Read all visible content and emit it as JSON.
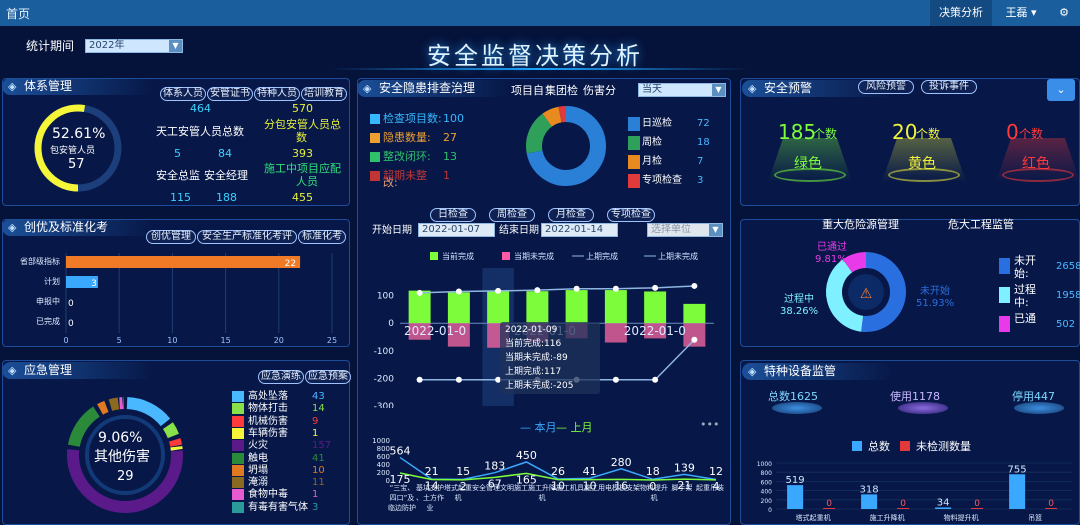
{
  "nav": {
    "brand": "首页",
    "menu": "决策分析",
    "user": "王磊 ▾",
    "gear": "⚙"
  },
  "title": "安全监督决策分析",
  "period": {
    "label": "统计期间",
    "value": "2022年"
  },
  "system": {
    "title": "体系管理",
    "pct": "52.61%",
    "pct_label": "包安管人员",
    "count": "57",
    "pills": [
      "体系人员",
      "安管证书",
      "特种人员",
      "培训教育"
    ],
    "v1": "464",
    "v2": "570",
    "lab_a": "天工安管人员总数",
    "lab_b1": "分包安管人员总",
    "lab_b2": "数",
    "r2a": "5",
    "r2b": "84",
    "r2c": "393",
    "lab_c": "安全总监",
    "lab_d": "安全经理",
    "lab_e1": "施工中项目应配",
    "lab_e2": "人员",
    "r3a": "115",
    "r3b": "188",
    "r3c": "455"
  },
  "hazard": {
    "title": "安全隐患排查治理",
    "tabs_text": "项目自",
    "tab2": "集团检",
    "tab3": "伤害分",
    "select": "当天",
    "stats": [
      {
        "label": "检查项目数:",
        "value": "100",
        "color": "#35b8ff"
      },
      {
        "label": "隐患数量:",
        "value": "27",
        "color": "#f0a030"
      },
      {
        "label": "整改闭环:",
        "value": "13",
        "color": "#2fc06a"
      },
      {
        "label": "超期未整",
        "value": "1",
        "color": "#c23535"
      }
    ],
    "stat4b": "改:",
    "legend": [
      {
        "label": "日巡检",
        "value": "72",
        "color": "#2a7fd6"
      },
      {
        "label": "周检",
        "value": "18",
        "color": "#2fa05a"
      },
      {
        "label": "月检",
        "value": "7",
        "color": "#e88a20"
      },
      {
        "label": "专项检查",
        "value": "3",
        "color": "#e03a3a"
      }
    ],
    "pie_values": [
      72,
      18,
      7,
      3
    ],
    "tabs2": [
      "日检查",
      "周检查",
      "月检查",
      "专项检查"
    ],
    "start_label": "开始日期",
    "start": "2022-01-07",
    "end_label": "结束日期",
    "end": "2022-01-14",
    "unit": "选择单位",
    "legend2": [
      "当前完成",
      "当期未完成",
      "上期完成",
      "上期未完成"
    ],
    "tooltip": [
      "2022-01-09",
      "当前完成:116",
      "当期未完成:-89",
      "上期完成:117",
      "上期未完成:-205"
    ],
    "axis_date": "2022-01-0"
  },
  "warn": {
    "title": "安全预警",
    "pill1": "风险预警",
    "pill2": "投诉事件",
    "items": [
      {
        "num": "185",
        "unit": "个数",
        "label": "绿色",
        "color": "#7cfc3a"
      },
      {
        "num": "20",
        "unit": "个数",
        "label": "黄色",
        "color": "#f2f23a"
      },
      {
        "num": "0",
        "unit": "个数",
        "label": "红色",
        "color": "#ff3a3a"
      }
    ]
  },
  "major": {
    "title": "重大危险源管理",
    "title2": "危大工程监管",
    "passed": "已通过",
    "passed_pct": "9.81%",
    "proc": "过程中",
    "proc_pct": "38.26%",
    "notstart": "未开始",
    "notstart_pct": "51.93%",
    "legend": [
      {
        "l1": "未开",
        "l2": "始:",
        "v": "2658",
        "color": "#2a6fe0"
      },
      {
        "l1": "过程",
        "l2": "中:",
        "v": "1958",
        "color": "#7ef0ff"
      },
      {
        "l1": "已通",
        "l2": "",
        "v": "502",
        "color": "#e83ae8"
      }
    ]
  },
  "innov": {
    "title": "创优及标准化考",
    "pills": [
      "创优管理",
      "安全生产标准化考评",
      "标准化考"
    ],
    "chart_data": {
      "type": "bar",
      "categories": [
        "省部级指标",
        "计划",
        "申报中",
        "已完成"
      ],
      "values": [
        22,
        3,
        0,
        0
      ],
      "xlim": [
        0,
        25
      ],
      "xticks": [
        0,
        5,
        10,
        15,
        20,
        25
      ]
    }
  },
  "emer": {
    "title": "应急管理",
    "pill1": "应急演练",
    "pill2": "应急预案",
    "pct": "9.06%",
    "label": "其他伤害",
    "count": "29",
    "legend": [
      {
        "label": "高处坠落",
        "value": "43",
        "color": "#4ab8ff"
      },
      {
        "label": "物体打击",
        "value": "14",
        "color": "#88e04a"
      },
      {
        "label": "机械伤害",
        "value": "9",
        "color": "#ff3a3a"
      },
      {
        "label": "车辆伤害",
        "value": "1",
        "color": "#f5f53a"
      },
      {
        "label": "火灾",
        "value": "157",
        "color": "#5a1a8a"
      },
      {
        "label": "触电",
        "value": "41",
        "color": "#2a8a3a"
      },
      {
        "label": "坍塌",
        "value": "10",
        "color": "#e07a20"
      },
      {
        "label": "淹溺",
        "value": "11",
        "color": "#8a6a20"
      },
      {
        "label": "食物中毒",
        "value": "1",
        "color": "#e85ad0"
      },
      {
        "label": "有毒有害气体",
        "value": "3",
        "color": "#2a9a9a"
      }
    ]
  },
  "equip": {
    "title": "特种设备监管",
    "total": "总数1625",
    "used": "使用1178",
    "stop": "停用447",
    "leg1": "总数",
    "leg2": "未检测数量",
    "chart_data": {
      "type": "bar",
      "categories": [
        "塔式起重机",
        "施工升降机",
        "物料提升机",
        "吊篮"
      ],
      "series": [
        {
          "name": "总数",
          "values": [
            519,
            318,
            34,
            755
          ]
        },
        {
          "name": "未检测数量",
          "values": [
            0,
            0,
            0,
            0
          ]
        }
      ],
      "ylim": [
        0,
        1000
      ],
      "yticks": [
        0,
        200,
        400,
        600,
        800,
        1000
      ]
    }
  },
  "chart_data": {
    "type": "bar",
    "categories": [
      "2022-01-07",
      "2022-01-08",
      "2022-01-09",
      "2022-01-10",
      "2022-01-11",
      "2022-01-12",
      "2022-01-13",
      "2022-01-14"
    ],
    "series": [
      {
        "name": "当前完成",
        "values": [
          118,
          112,
          116,
          116,
          120,
          120,
          115,
          70
        ]
      },
      {
        "name": "当期未完成",
        "values": [
          -60,
          -85,
          -89,
          -70,
          -55,
          -70,
          -55,
          -85
        ]
      },
      {
        "name": "上期完成",
        "values": [
          110,
          115,
          117,
          120,
          125,
          125,
          128,
          135
        ]
      },
      {
        "name": "上期未完成",
        "values": [
          -205,
          -205,
          -205,
          -205,
          -205,
          -205,
          -205,
          -60
        ]
      }
    ],
    "ylim": [
      -300,
      200
    ],
    "yticks": [
      100,
      0,
      -100,
      -200,
      -300
    ]
  },
  "bottom_chart": {
    "legend1": "本月",
    "legend2": "上月",
    "more": "•••",
    "chart_data": {
      "type": "line",
      "categories": [
        "“三宝、四口”及临边防护",
        "基坑支护、土方作业",
        "塔式起重机",
        "安全管理",
        "文明施工",
        "施工升降机",
        "施工用电",
        "模板支架",
        "物料提升机",
        "脚手架",
        "起重吊装"
      ],
      "series": [
        {
          "name": "本月",
          "values": [
            564,
            21,
            15,
            183,
            450,
            26,
            41,
            280,
            18,
            139,
            12
          ]
        },
        {
          "name": "上月",
          "values": [
            175,
            14,
            2,
            67,
            165,
            10,
            10,
            16,
            0,
            21,
            4
          ]
        }
      ],
      "yticks": [
        0,
        200,
        400,
        600,
        800,
        1000
      ]
    },
    "xl": [
      "“三宝、四口”及临边防护",
      "基坑支护、土方作业",
      "塔式起重机",
      "安全管理",
      "文明施工",
      "施工升降机",
      "施工机具",
      "施工用电",
      "模板支架",
      "物料提升机",
      "脚手架",
      "起重吊装"
    ]
  }
}
